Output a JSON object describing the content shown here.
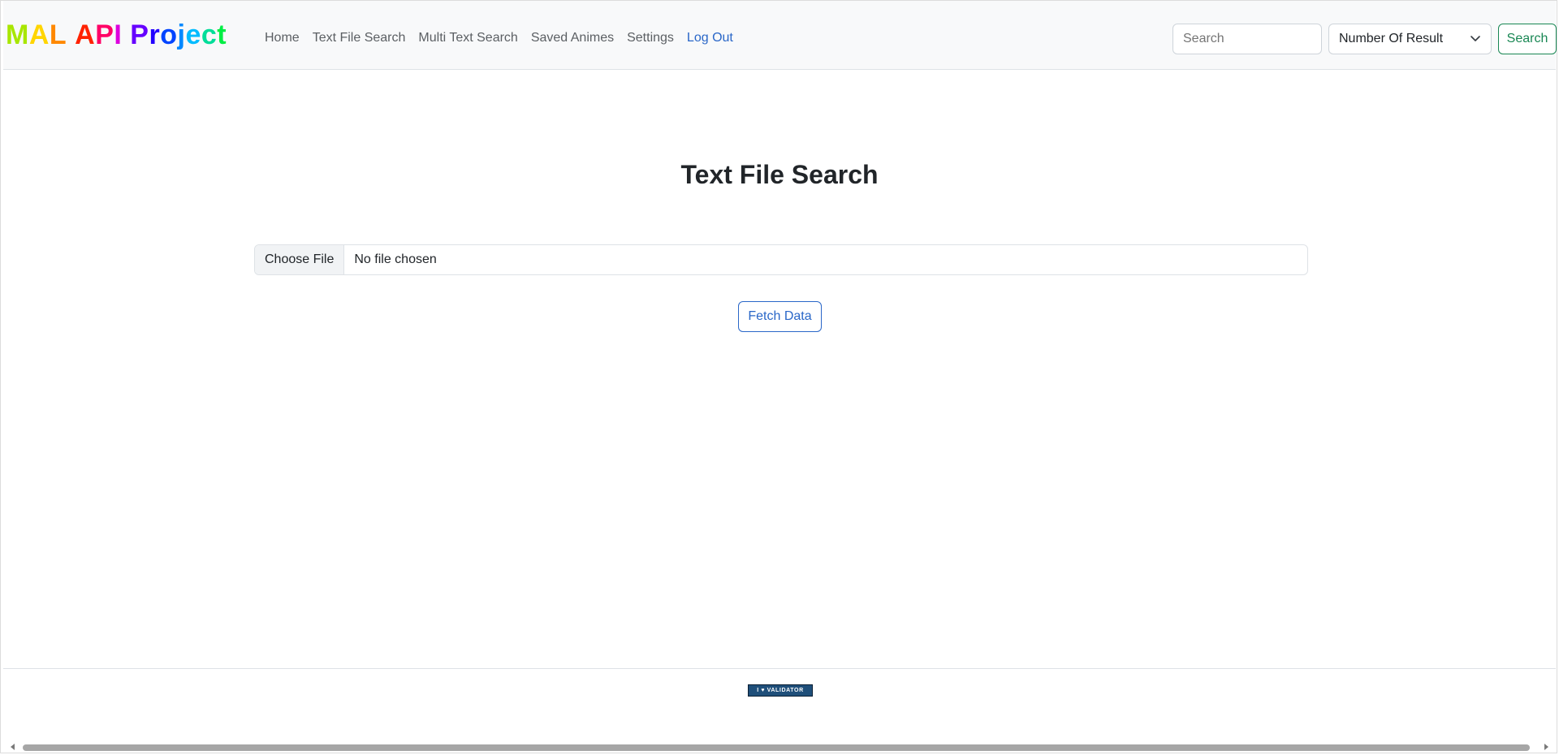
{
  "navbar": {
    "brand": "MAL API Project",
    "brand_colors": [
      "#a8e600",
      "#ffd500",
      "#ff8800",
      "#ff2200",
      "#ff0066",
      "#dd00dd",
      "#6600ff",
      "#2200ff",
      "#0044ff",
      "#0088ff",
      "#00bbff",
      "#00dd99",
      "#00ee44",
      "#33ee00",
      "#55ee00"
    ],
    "links": [
      {
        "label": "Home"
      },
      {
        "label": "Text File Search"
      },
      {
        "label": "Multi Text Search"
      },
      {
        "label": "Saved Animes"
      },
      {
        "label": "Settings"
      },
      {
        "label": "Log Out"
      }
    ],
    "search_placeholder": "Search",
    "result_select": "Number Of Result",
    "search_button": "Search",
    "colors": {
      "success": "#198754",
      "primary": "#2a67c8",
      "nav_bg": "#f8f9fa"
    }
  },
  "main": {
    "title": "Text File Search",
    "file_button": "Choose File",
    "file_status": "No file chosen",
    "fetch_button": "Fetch Data"
  },
  "footer": {
    "badge": "I ♥ VALIDATOR"
  }
}
